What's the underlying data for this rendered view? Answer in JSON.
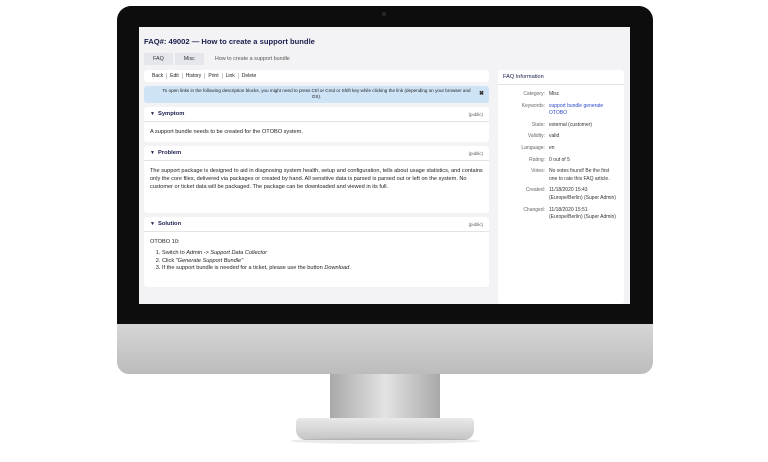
{
  "faq": {
    "title": "FAQ#: 49002 — How to create a support bundle",
    "breadcrumb": [
      "FAQ",
      "Misc",
      "How to create a support bundle"
    ]
  },
  "toolbar": [
    "Back",
    "Edit",
    "History",
    "Print",
    "Link",
    "Delete"
  ],
  "notice": {
    "text": "To open links in the following description blocks, you might need to press Ctrl or Cmd or Shift key while clicking the link (depending on your browser and OS).",
    "close": "✖"
  },
  "symptom": {
    "heading": "Symptom",
    "visibility": "(public)",
    "text": "A support bundle needs to be created for the OTOBO system."
  },
  "problem": {
    "heading": "Problem",
    "visibility": "(public)",
    "text": "The support package is designed to aid in diagnosing system health, setup and configuration, tells about usage statistics, and contains only the core files, delivered via packages or created by hand. All sensitive data is parsed is parsed out or left on the system. No customer or ticket data will be packaged. The package can be downloaded and viewed in its full."
  },
  "solution": {
    "heading": "Solution",
    "visibility": "(public)",
    "intro": "OTOBO 10:",
    "step1_prefix": "Switch to ",
    "step1_em": "Admin -> Support Data Collector",
    "step2_prefix": "Click ",
    "step2_em": "\"Generate Support Bundle\"",
    "step3_prefix": "If the support bundle is needed for a ticket, please use the button ",
    "step3_em": "Download",
    "step3_suffix": "."
  },
  "info": {
    "title": "FAQ Information",
    "rows": [
      {
        "label": "Category:",
        "value": "Misc"
      },
      {
        "label": "Keywords:",
        "value": "support bundle generate OTOBO"
      },
      {
        "label": "State:",
        "value": "external (customer)"
      },
      {
        "label": "Validity:",
        "value": "valid"
      },
      {
        "label": "Language:",
        "value": "en"
      },
      {
        "label": "Rating:",
        "value": "0 out of 5"
      },
      {
        "label": "Votes:",
        "value": "No votes found! Be the first one to rate this FAQ article."
      },
      {
        "label": "Created:",
        "value": "11/18/2020 15:43 (Europe/Berlin) (Super Admin)"
      },
      {
        "label": "Changed:",
        "value": "11/18/2020 15:51 (Europe/Berlin) (Super Admin)"
      }
    ]
  },
  "colors": {
    "title": "#1a1f4d",
    "notice_bg": "#cfe3f6",
    "link": "#2b49c8"
  }
}
